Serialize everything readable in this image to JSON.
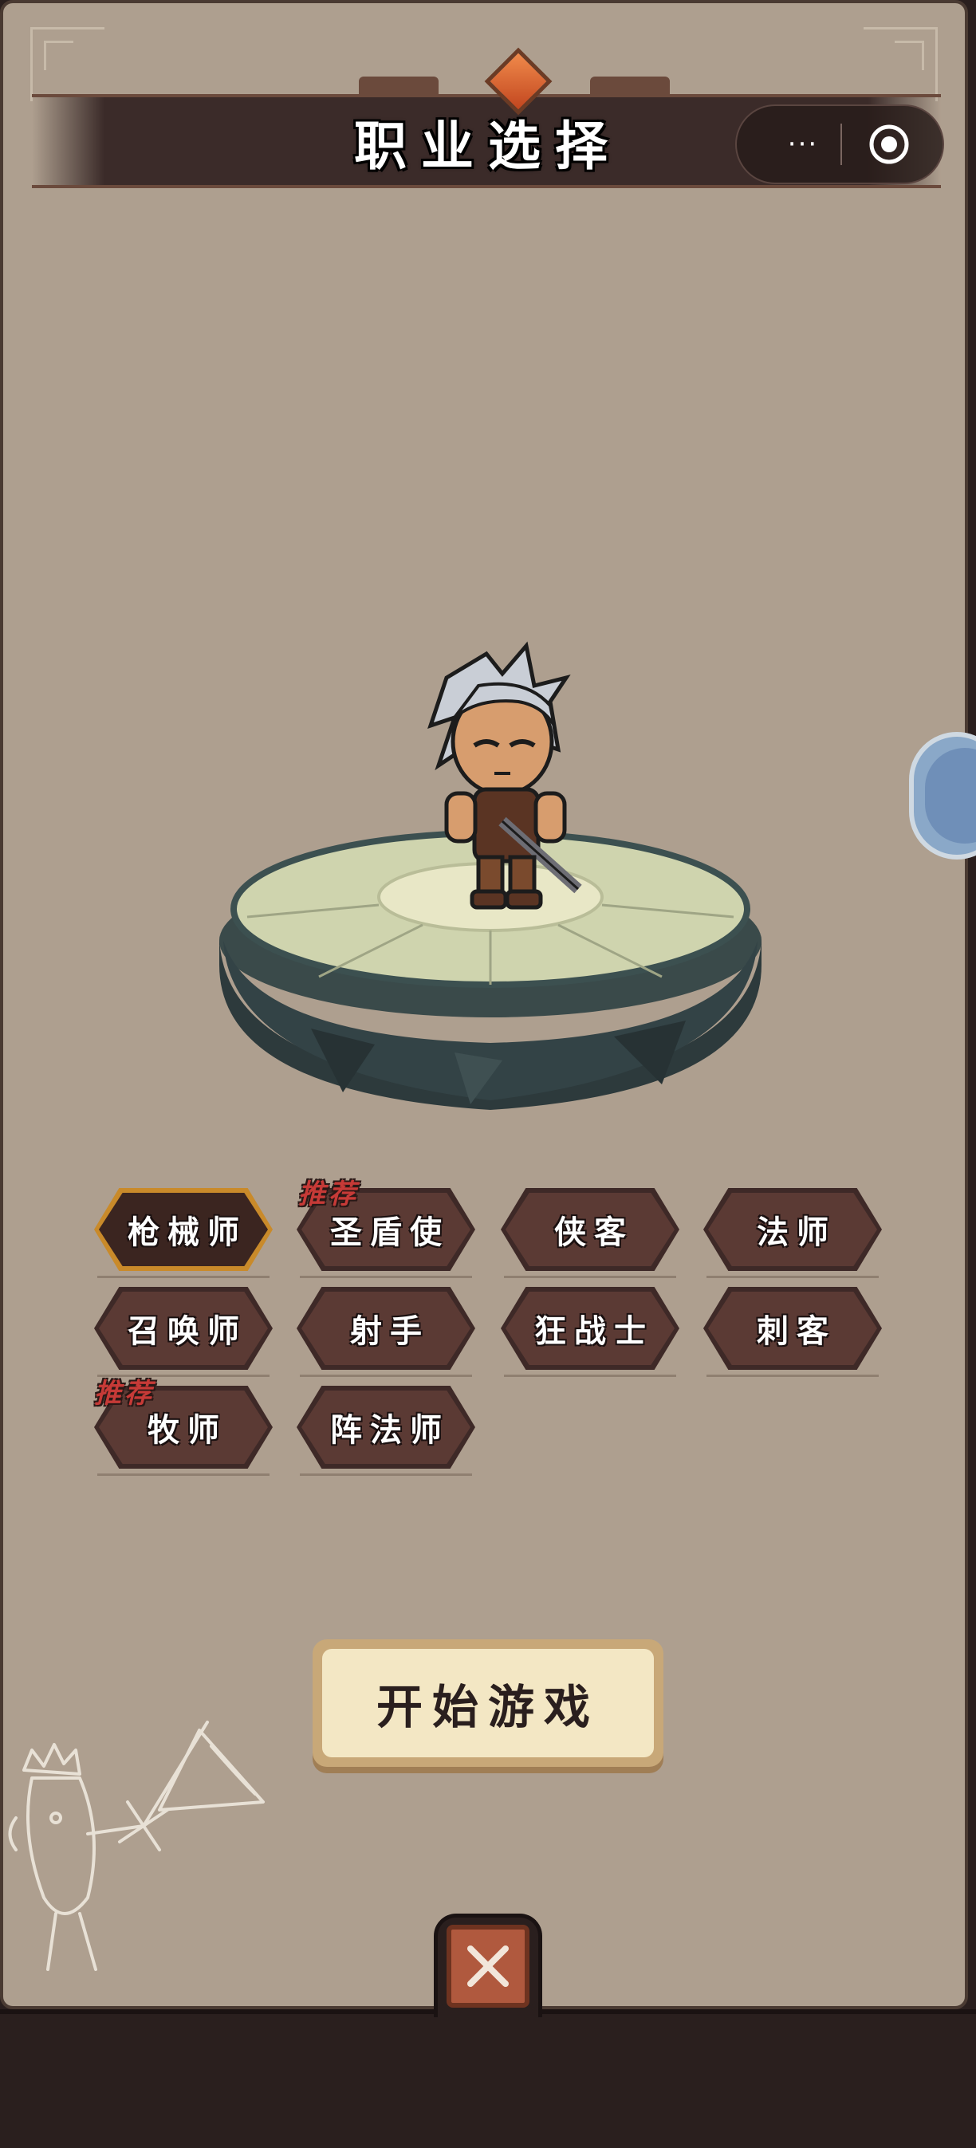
{
  "header": {
    "title": "职业选择",
    "more_icon": "···",
    "more_button": "more-options",
    "close_button": "mini-program-close"
  },
  "classes": [
    {
      "label": "枪械师",
      "selected": true,
      "recommended": false
    },
    {
      "label": "圣盾使",
      "selected": false,
      "recommended": true
    },
    {
      "label": "侠客",
      "selected": false,
      "recommended": false
    },
    {
      "label": "法师",
      "selected": false,
      "recommended": false
    },
    {
      "label": "召唤师",
      "selected": false,
      "recommended": false
    },
    {
      "label": "射手",
      "selected": false,
      "recommended": false
    },
    {
      "label": "狂战士",
      "selected": false,
      "recommended": false
    },
    {
      "label": "刺客",
      "selected": false,
      "recommended": false
    },
    {
      "label": "牧师",
      "selected": false,
      "recommended": true
    },
    {
      "label": "阵法师",
      "selected": false,
      "recommended": false
    }
  ],
  "recommend_tag": "推荐",
  "start_button": {
    "label": "开始游戏"
  },
  "colors": {
    "panel": "#ae9f8f",
    "button_dark": "#3e2927",
    "selected_border": "#c98a2a",
    "recommend_red": "#c63a37",
    "start_fill": "#f3e7c4"
  }
}
